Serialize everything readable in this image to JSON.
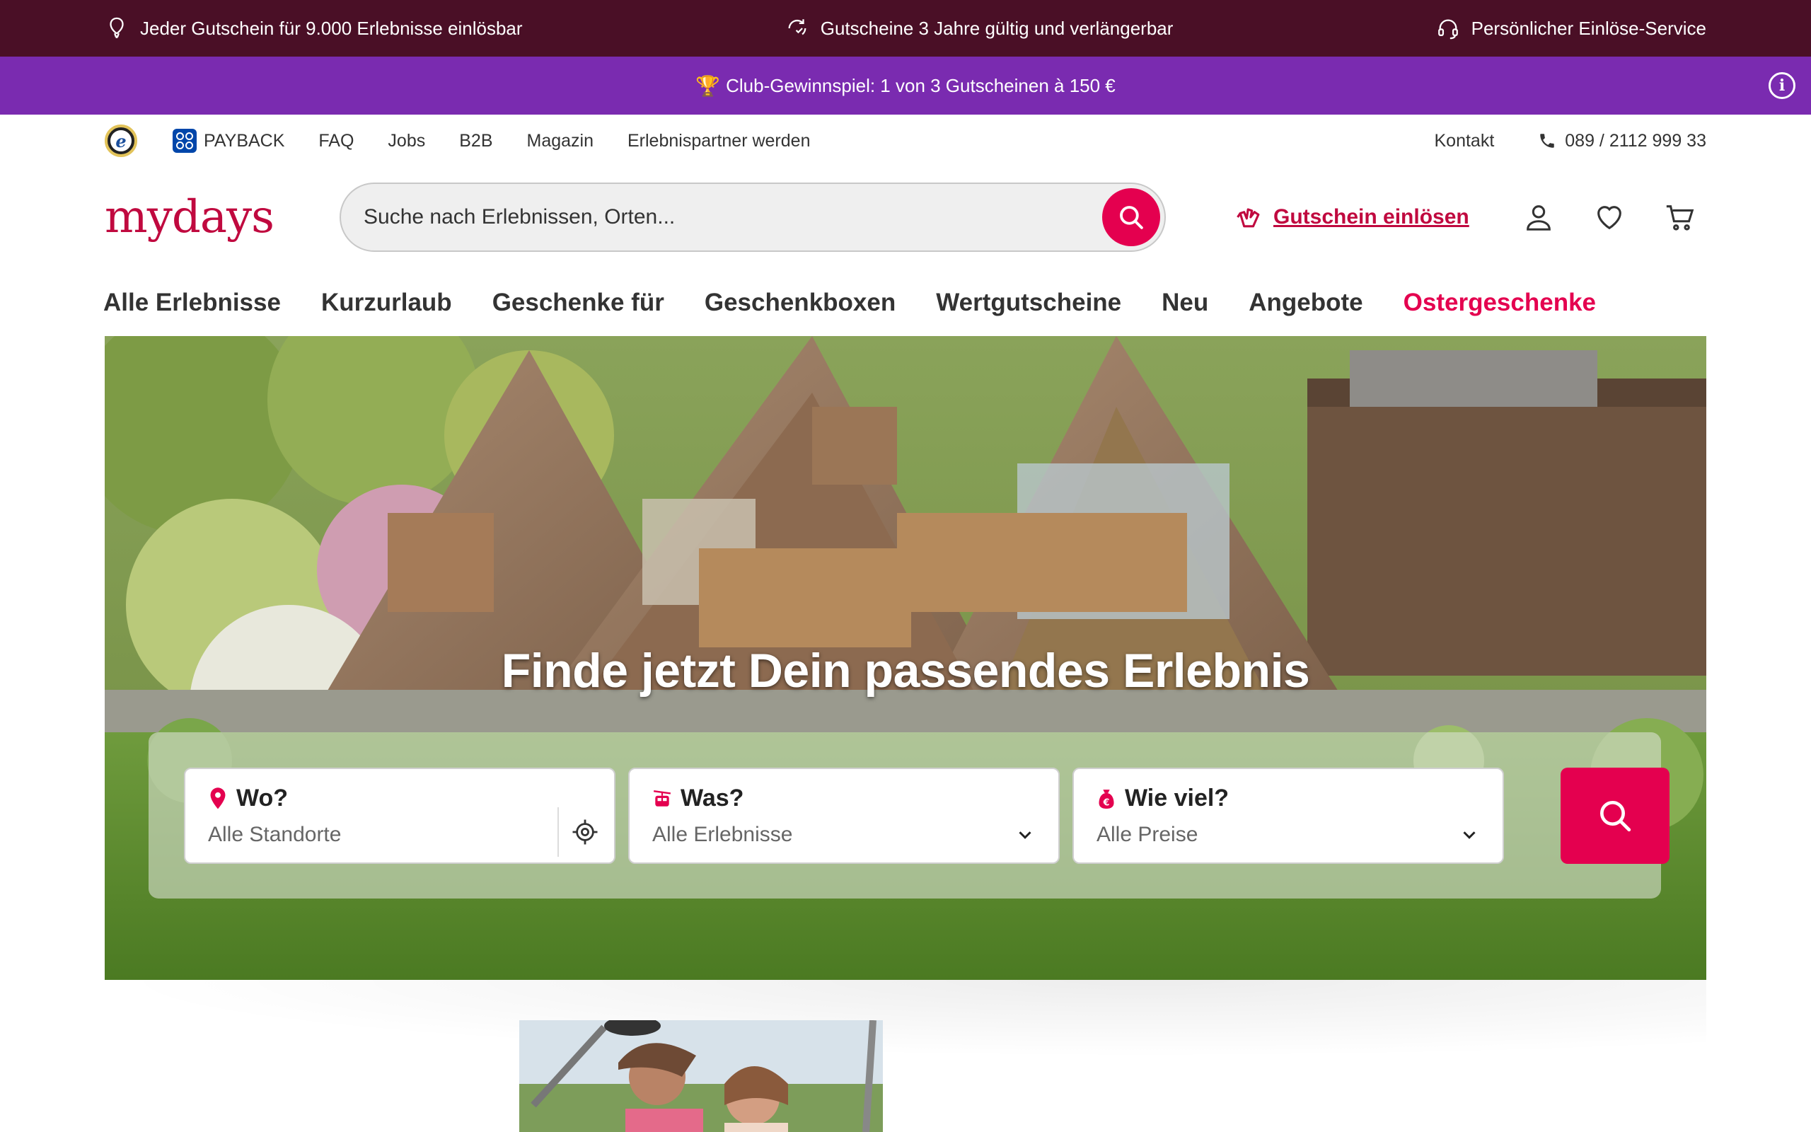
{
  "usp": [
    {
      "icon": "balloon-icon",
      "text": "Jeder Gutschein für 9.000 Erlebnisse einlösbar"
    },
    {
      "icon": "refresh-icon",
      "text": "Gutscheine 3 Jahre gültig und verlängerbar"
    },
    {
      "icon": "headset-icon",
      "text": "Persönlicher Einlöse-Service"
    }
  ],
  "promo": {
    "icon": "trophy-icon",
    "text": "Club-Gewinnspiel: 1 von 3 Gutscheinen à 150 €",
    "info_icon": "info-icon"
  },
  "service_nav": {
    "trust_badge": "e",
    "payback": "PAYBACK",
    "links": [
      "FAQ",
      "Jobs",
      "B2B",
      "Magazin",
      "Erlebnispartner werden"
    ],
    "kontakt": "Kontakt",
    "phone": "089 / 2112 999 33"
  },
  "header": {
    "logo": "mydays",
    "search_placeholder": "Suche nach Erlebnissen, Orten...",
    "redeem": "Gutschein einlösen"
  },
  "categories": [
    "Alle Erlebnisse",
    "Kurzurlaub",
    "Geschenke für",
    "Geschenkboxen",
    "Wertgutscheine",
    "Neu",
    "Angebote",
    "Ostergeschenke"
  ],
  "hero": {
    "title": "Finde jetzt Dein passendes Erlebnis",
    "fields": {
      "where": {
        "label": "Wo?",
        "value": "Alle Standorte"
      },
      "what": {
        "label": "Was?",
        "value": "Alle Erlebnisse"
      },
      "price": {
        "label": "Wie viel?",
        "value": "Alle Preise"
      }
    }
  },
  "colors": {
    "brand": "#c0093f",
    "accent": "#e4004f",
    "usp_bar": "#4a0f26",
    "promo_bar": "#7a2bb0"
  }
}
